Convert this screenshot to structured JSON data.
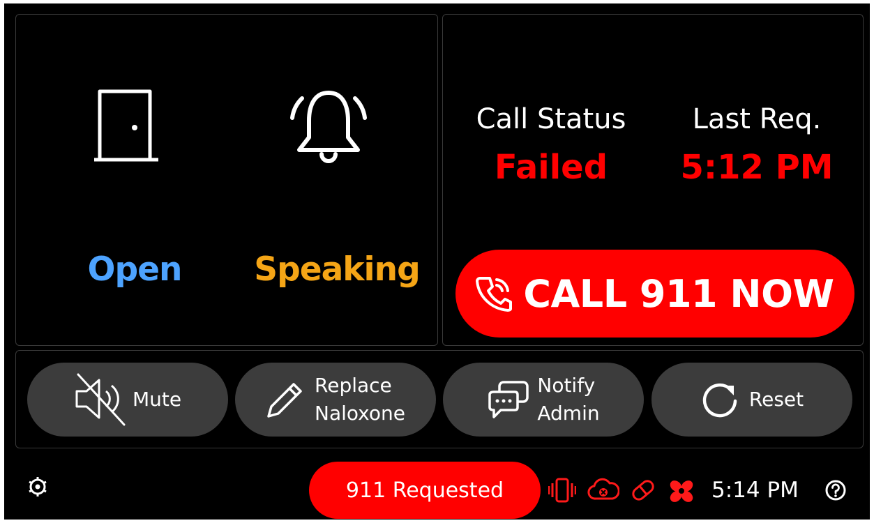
{
  "status": {
    "door": {
      "icon": "door-icon",
      "label": "Open",
      "color": "#4da3ff"
    },
    "alarm": {
      "icon": "bell-ringing-icon",
      "label": "Speaking",
      "color": "#f5a516"
    }
  },
  "call": {
    "status_title": "Call Status",
    "status_value": "Failed",
    "last_req_title": "Last Req.",
    "last_req_value": "5:12 PM",
    "button_icon": "phone-icon",
    "button_label": "CALL 911 NOW",
    "accent": "#ff0000"
  },
  "actions": [
    {
      "icon": "mute-icon",
      "label": "Mute"
    },
    {
      "icon": "pencil-icon",
      "label": "Replace\nNaloxone"
    },
    {
      "icon": "chat-bubbles-icon",
      "label": "Notify\nAdmin"
    },
    {
      "icon": "reset-icon",
      "label": "Reset"
    }
  ],
  "footer": {
    "settings_icon": "settings-icon",
    "requested_label": "911 Requested",
    "tray_icons": [
      "vibrate-icon",
      "cloud-error-icon",
      "pill-icon",
      "fan-icon"
    ],
    "time": "5:14 PM",
    "help_icon": "help-icon"
  }
}
